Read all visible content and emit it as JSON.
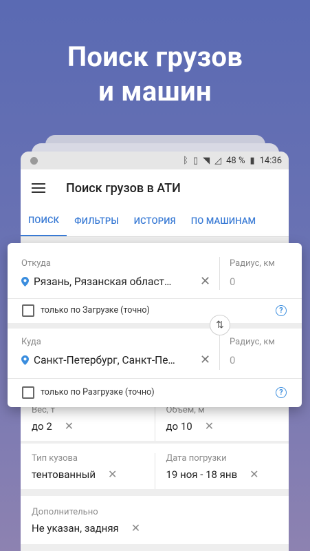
{
  "promo": {
    "line1": "Поиск грузов",
    "line2": "и машин"
  },
  "status": {
    "battery": "48 %",
    "time": "14:36"
  },
  "appbar": {
    "title": "Поиск грузов в АТИ"
  },
  "tabs": [
    "ПОИСК",
    "ФИЛЬТРЫ",
    "ИСТОРИЯ",
    "ПО МАШИНАМ"
  ],
  "from": {
    "label": "Откуда",
    "value": "Рязань, Рязанская област…",
    "radius_label": "Радиус, км",
    "radius_value": "0",
    "check_label": "только по Загрузке (точно)"
  },
  "to": {
    "label": "Куда",
    "value": "Санкт-Петербург, Санкт-Пе…",
    "radius_label": "Радиус, км",
    "radius_value": "0",
    "check_label": "только по Разгрузке (точно)"
  },
  "filters": {
    "weight_label": "Вес, т",
    "weight_value": "до 2",
    "volume_label": "Объем, м",
    "volume_value": "до 10",
    "body_label": "Тип кузова",
    "body_value": "тентованный",
    "date_label": "Дата погрузки",
    "date_value": "19 ноя - 18 янв",
    "extra_label": "Дополнительно",
    "extra_value": "Не указан, задняя"
  },
  "colors": {
    "accent": "#3a7bd5",
    "pin": "#3a8dde"
  }
}
